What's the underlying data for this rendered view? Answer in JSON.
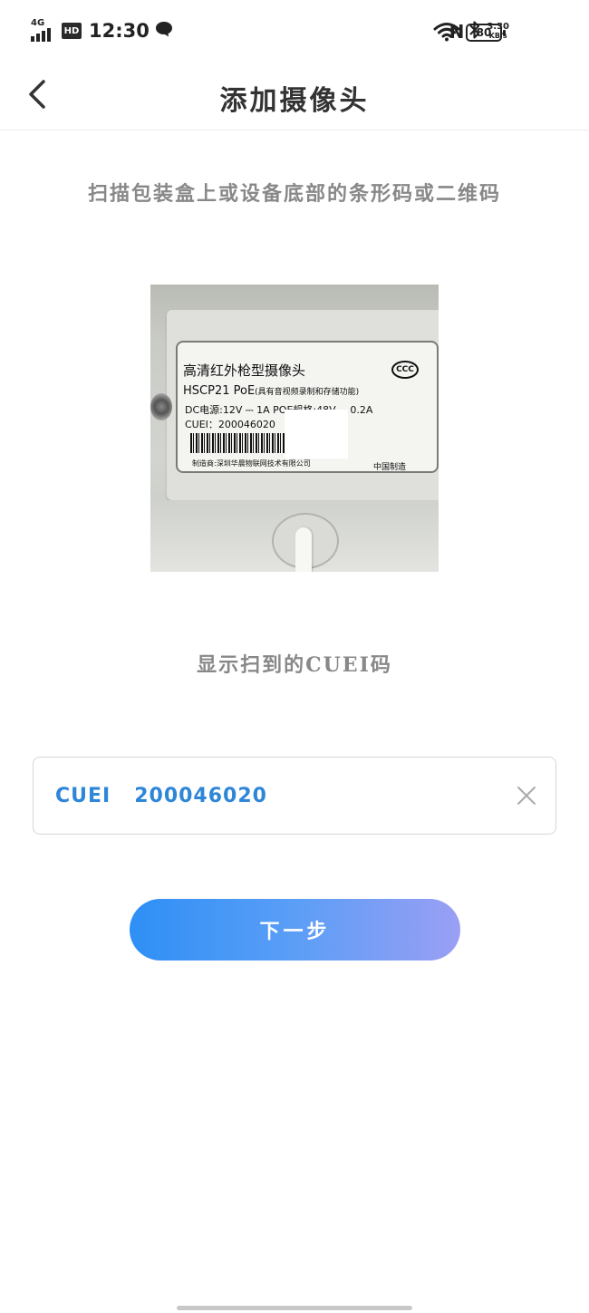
{
  "status_bar": {
    "network": "4G",
    "hd": "HD",
    "time": "12:30",
    "nfc": "N",
    "speed_value": "3.30",
    "speed_unit": "KB/s",
    "battery": "80"
  },
  "nav": {
    "title": "添加摄像头"
  },
  "instruction": "扫描包装盒上或设备底部的条形码或二维码",
  "photo_label": {
    "line1": "高清红外枪型摄像头",
    "ccc": "CCC",
    "line2_main": "HSCP21 PoE",
    "line2_note": "(具有音视频录制和存储功能)",
    "line3": "DC电源:12V ⎓ 1A  POE规格:48V ⎓ 0.2A",
    "line4": "CUEI：200046020",
    "manufacturer": "制造商:深圳华晨物联网技术有限公司",
    "made_in": "中国制造"
  },
  "result_caption": "显示扫到的CUEI码",
  "input": {
    "value": "CUEI   200046020"
  },
  "next_button": "下一步",
  "colors": {
    "accent_blue": "#2e86d8",
    "button_gradient_start": "#2e8ff5",
    "button_gradient_end": "#9a9ff4",
    "caption_gray": "#888888"
  },
  "icons": {
    "back": "chevron-left-icon",
    "clear": "close-icon",
    "wifi": "wifi-icon",
    "bluetooth": "bluetooth-icon",
    "message": "message-bubble-icon"
  }
}
